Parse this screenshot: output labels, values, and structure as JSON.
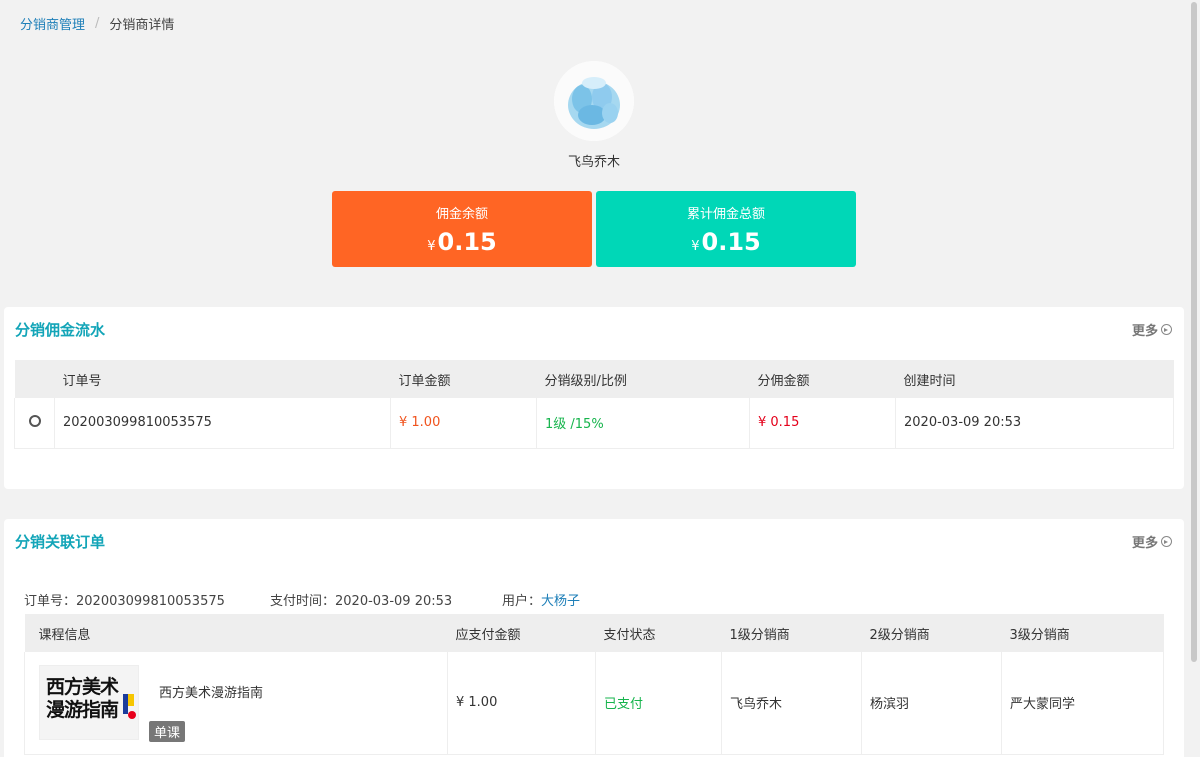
{
  "breadcrumb": {
    "parent": "分销商管理",
    "current": "分销商详情"
  },
  "profile": {
    "nickname": "飞鸟乔木"
  },
  "stats": [
    {
      "label": "佣金余额",
      "currency": "¥",
      "value": "0.15",
      "color": "#ff6524"
    },
    {
      "label": "累计佣金总额",
      "currency": "¥",
      "value": "0.15",
      "color": "#00d7b7"
    }
  ],
  "commission": {
    "title": "分销佣金流水",
    "more": "更多",
    "columns": [
      "订单号",
      "订单金额",
      "分销级别/比例",
      "分佣金额",
      "创建时间"
    ],
    "rows": [
      {
        "order_no": "202003099810053575",
        "amount": "¥ 1.00",
        "level": "1级 /15%",
        "commission": "¥ 0.15",
        "created": "2020-03-09 20:53"
      }
    ]
  },
  "orders": {
    "title": "分销关联订单",
    "more": "更多",
    "order_no_label": "订单号：",
    "order_no": "202003099810053575",
    "pay_time_label": "支付时间：",
    "pay_time": "2020-03-09 20:53",
    "user_label": "用户：",
    "user": "大杨子",
    "columns": [
      "课程信息",
      "应支付金额",
      "支付状态",
      "1级分销商",
      "2级分销商",
      "3级分销商"
    ],
    "rows": [
      {
        "course_name": "西方美术漫游指南",
        "thumb_text": "西方美术漫游指南",
        "badge": "单课",
        "amount": "¥ 1.00",
        "status": "已支付",
        "level1": "飞鸟乔木",
        "level2": "杨滨羽",
        "level3": "严大蒙同学"
      }
    ]
  }
}
